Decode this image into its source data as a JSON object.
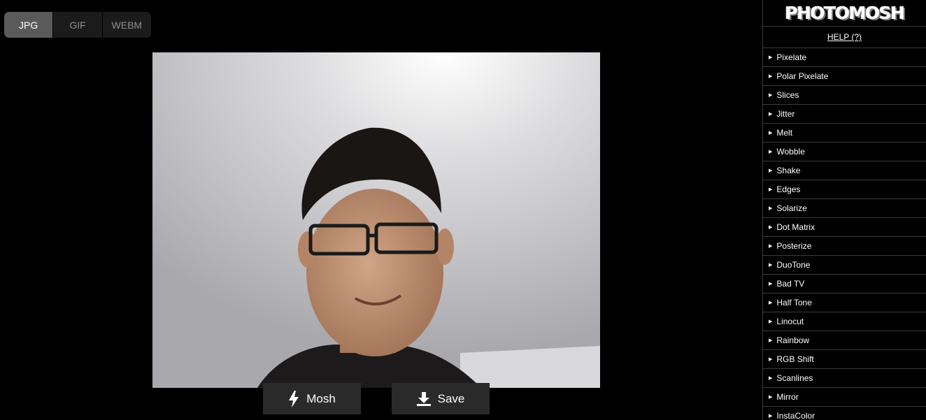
{
  "format_tabs": [
    {
      "label": "JPG",
      "active": true
    },
    {
      "label": "GIF",
      "active": false
    },
    {
      "label": "WEBM",
      "active": false
    }
  ],
  "preview": {
    "icon": "webcam-image"
  },
  "buttons": {
    "mosh_label": "Mosh",
    "mosh_icon": "lightning-icon",
    "save_label": "Save",
    "save_icon": "download-icon"
  },
  "sidebar": {
    "logo": "PHOTOMOSH",
    "help_label": "HELP (?)",
    "effects": [
      "Pixelate",
      "Polar Pixelate",
      "Slices",
      "Jitter",
      "Melt",
      "Wobble",
      "Shake",
      "Edges",
      "Solarize",
      "Dot Matrix",
      "Posterize",
      "DuoTone",
      "Bad TV",
      "Half Tone",
      "Linocut",
      "Rainbow",
      "RGB Shift",
      "Scanlines",
      "Mirror",
      "InstaColor"
    ]
  },
  "colors": {
    "background": "#000000",
    "tab_active": "#5a5a5a",
    "tab_inactive": "#1b1b1b",
    "button_bg": "#2a2a2a",
    "divider": "#3a3a3a"
  }
}
